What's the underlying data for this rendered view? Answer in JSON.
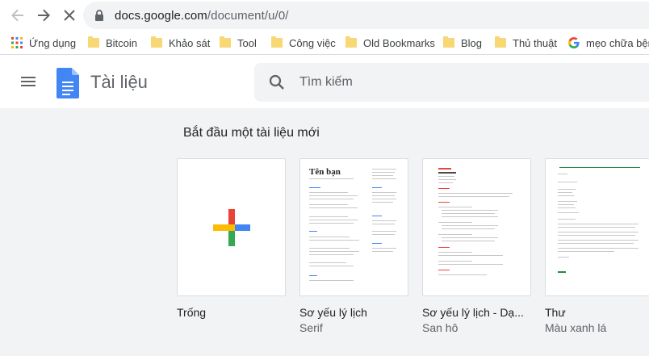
{
  "browser": {
    "url_host": "docs.google.com",
    "url_path": "/document/u/0/"
  },
  "bookmarks": [
    {
      "label": "Ứng dụng",
      "icon": "apps-grid-icon"
    },
    {
      "label": "Bitcoin",
      "icon": "folder-icon"
    },
    {
      "label": "Khảo sát",
      "icon": "folder-icon"
    },
    {
      "label": "Tool",
      "icon": "folder-icon"
    },
    {
      "label": "Công việc",
      "icon": "folder-icon"
    },
    {
      "label": "Old Bookmarks",
      "icon": "folder-icon"
    },
    {
      "label": "Blog",
      "icon": "folder-icon"
    },
    {
      "label": "Thủ thuật",
      "icon": "folder-icon"
    },
    {
      "label": "mẹo chữa bện",
      "icon": "google-g-icon"
    }
  ],
  "header": {
    "app_title": "Tài liệu",
    "search_placeholder": "Tìm kiếm"
  },
  "gallery": {
    "title": "Bắt đầu một tài liệu mới",
    "templates": [
      {
        "name": "Trống",
        "subtitle": ""
      },
      {
        "name": "Sơ yếu lý lịch",
        "subtitle": "Serif",
        "thumb_heading": "Tên bạn"
      },
      {
        "name": "Sơ yếu lý lịch - Dạ...",
        "subtitle": "San hô"
      },
      {
        "name": "Thư",
        "subtitle": "Màu xanh lá"
      }
    ]
  },
  "colors": {
    "google_blue": "#4285f4",
    "google_red": "#ea4335",
    "google_yellow": "#fbbc04",
    "google_green": "#34a853",
    "coral": "#e8453c",
    "letter_green": "#1e8e3e"
  }
}
